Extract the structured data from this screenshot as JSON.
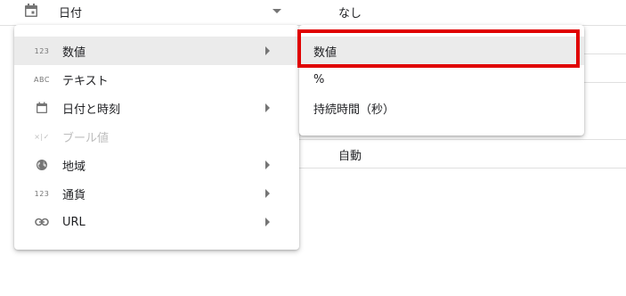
{
  "field_row": {
    "type_label": "日付",
    "aggregation": "なし",
    "icon": "calendar-icon"
  },
  "lower_row": {
    "aggregation": "自動"
  },
  "menu": {
    "items": [
      {
        "icon_text": "123",
        "label": "数値",
        "has_submenu": true,
        "active": true
      },
      {
        "icon_text": "ABC",
        "label": "テキスト",
        "has_submenu": false
      },
      {
        "icon": "calendar-icon",
        "label": "日付と時刻",
        "has_submenu": true
      },
      {
        "icon_text": "×|✓",
        "label": "ブール値",
        "has_submenu": false,
        "disabled": true
      },
      {
        "icon": "globe-icon",
        "label": "地域",
        "has_submenu": true
      },
      {
        "icon_text": "123",
        "label": "通貨",
        "has_submenu": true
      },
      {
        "icon": "link-icon",
        "label": "URL",
        "has_submenu": true
      }
    ]
  },
  "submenu": {
    "items": [
      {
        "label": "数値",
        "active": true
      },
      {
        "label": "%"
      },
      {
        "label": "持続時間（秒）"
      }
    ]
  },
  "colors": {
    "highlight": "#e00000",
    "active_bg": "#ebebeb"
  }
}
